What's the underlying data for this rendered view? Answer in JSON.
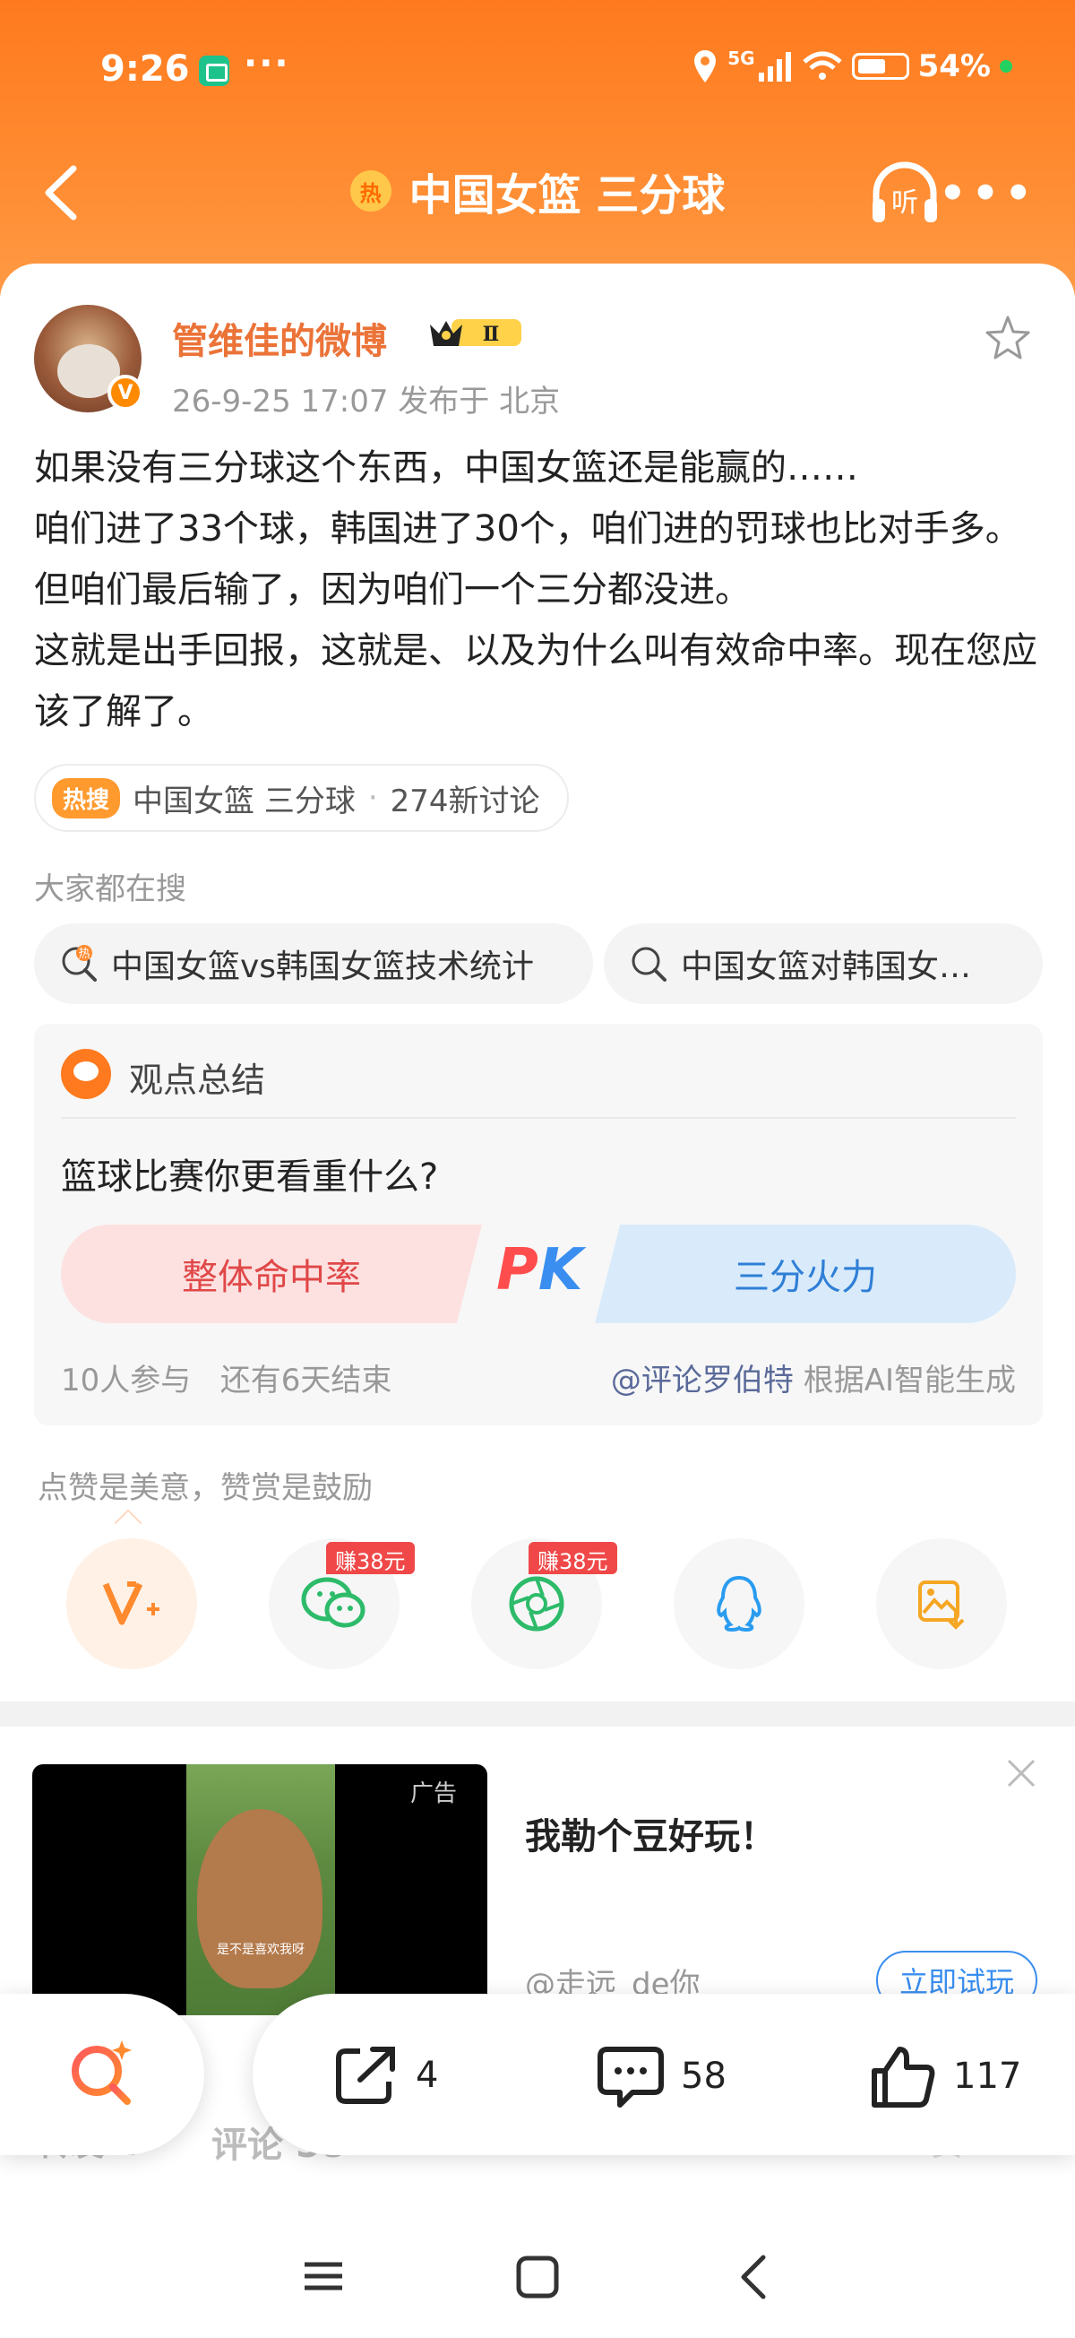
{
  "status_bar": {
    "time": "9:26",
    "dots": "···",
    "network": "5G",
    "battery": "54%"
  },
  "header": {
    "hot_icon": "热",
    "title": "中国女篮 三分球",
    "listen_label": "听"
  },
  "post": {
    "author": "管维佳的微博",
    "vip_level": "Ⅱ",
    "meta": "26-9-25 17:07  发布于 北京",
    "paragraphs": [
      "如果没有三分球这个东西，中国女篮还是能赢的……",
      "咱们进了33个球，韩国进了30个，咱们进的罚球也比对手多。但咱们最后输了，因为咱们一个三分都没进。",
      "这就是出手回报，这就是、以及为什么叫有效命中率。现在您应该了解了。"
    ]
  },
  "topic": {
    "badge": "热搜",
    "name": "中国女篮 三分球",
    "sep": "·",
    "count": "274新讨论"
  },
  "searches": {
    "title": "大家都在搜",
    "items": [
      "中国女篮vs韩国女篮技术统计",
      "中国女篮对韩国女…"
    ]
  },
  "opinion": {
    "title": "观点总结",
    "question": "篮球比赛你更看重什么?",
    "option_left": "整体命中率",
    "pk_p": "P",
    "pk_k": "K",
    "option_right": "三分火力",
    "participants": "10人参与",
    "remaining": "还有6天结束",
    "source_user": "@评论罗伯特",
    "source_note": " 根据AI智能生成"
  },
  "reward": {
    "text": "点赞是美意，赞赏是鼓励",
    "earn_label": "赚38元"
  },
  "ad": {
    "tag": "广告",
    "title": "我勒个豆好玩！",
    "user": "@走远_de你",
    "button": "立即试玩",
    "subtitle": "是不是喜欢我呀"
  },
  "behind": {
    "left": "转发 4",
    "comments": "评论 58",
    "right": "赞 117"
  },
  "actions": {
    "repost": "4",
    "comment": "58",
    "like": "117"
  },
  "colors": {
    "brand_orange": "#ff7a1e",
    "link_orange": "#eb7338",
    "pk_red": "#e04848",
    "pk_blue": "#2f7fd6"
  }
}
